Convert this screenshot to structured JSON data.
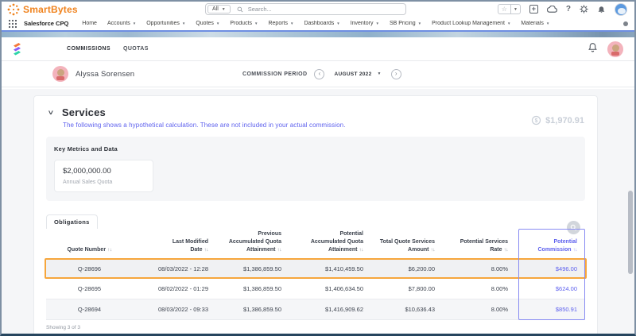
{
  "header": {
    "brand": "SmartBytes",
    "search_scope": "All",
    "search_placeholder": "Search..."
  },
  "nav": {
    "app_name": "Salesforce CPQ",
    "items": [
      {
        "label": "Home"
      },
      {
        "label": "Accounts"
      },
      {
        "label": "Opportunities"
      },
      {
        "label": "Quotes"
      },
      {
        "label": "Products"
      },
      {
        "label": "Reports"
      },
      {
        "label": "Dashboards"
      },
      {
        "label": "Inventory"
      },
      {
        "label": "SB Pricing"
      },
      {
        "label": "Product Lookup Management"
      },
      {
        "label": "Materials"
      }
    ]
  },
  "appbar": {
    "tabs": [
      {
        "label": "COMMISSIONS"
      },
      {
        "label": "QUOTAS"
      }
    ]
  },
  "person": {
    "name": "Alyssa Sorensen",
    "period_label": "COMMISSION PERIOD",
    "period_value": "AUGUST 2022"
  },
  "services": {
    "title": "Services",
    "note": "The following shows a hypothetical calculation. These are not included in your actual commission.",
    "total": "$1,970.91"
  },
  "key_metrics": {
    "title": "Key Metrics and Data",
    "value": "$2,000,000.00",
    "label": "Annual Sales Quota"
  },
  "obligations": {
    "tab": "Obligations",
    "columns": [
      {
        "lines": [
          "Quote Number"
        ]
      },
      {
        "lines": [
          "Last Modified",
          "Date"
        ]
      },
      {
        "lines": [
          "Previous",
          "Accumulated Quota",
          "Attainment"
        ]
      },
      {
        "lines": [
          "Potential",
          "Accumulated Quota",
          "Attainment"
        ]
      },
      {
        "lines": [
          "Total Quote Services",
          "Amount"
        ]
      },
      {
        "lines": [
          "Potential Services",
          "Rate"
        ]
      },
      {
        "lines": [
          "Potential",
          "Commission"
        ]
      }
    ],
    "rows": [
      {
        "cells": [
          "Q-28696",
          "08/03/2022 - 12:28",
          "$1,386,859.50",
          "$1,410,459.50",
          "$6,200.00",
          "8.00%",
          "$496.00"
        ],
        "highlighted": true
      },
      {
        "cells": [
          "Q-28695",
          "08/02/2022 - 01:29",
          "$1,386,859.50",
          "$1,406,634.50",
          "$7,800.00",
          "8.00%",
          "$624.00"
        ],
        "highlighted": false
      },
      {
        "cells": [
          "Q-28694",
          "08/03/2022 - 09:33",
          "$1,386,859.50",
          "$1,416,909.62",
          "$10,636.43",
          "8.00%",
          "$850.91"
        ],
        "highlighted": false
      }
    ],
    "footer": "Showing 3 of 3"
  },
  "colors": {
    "highlight_orange": "#F6A63C",
    "accent_violet": "#5E61EE",
    "brand_orange": "#F0831E"
  }
}
